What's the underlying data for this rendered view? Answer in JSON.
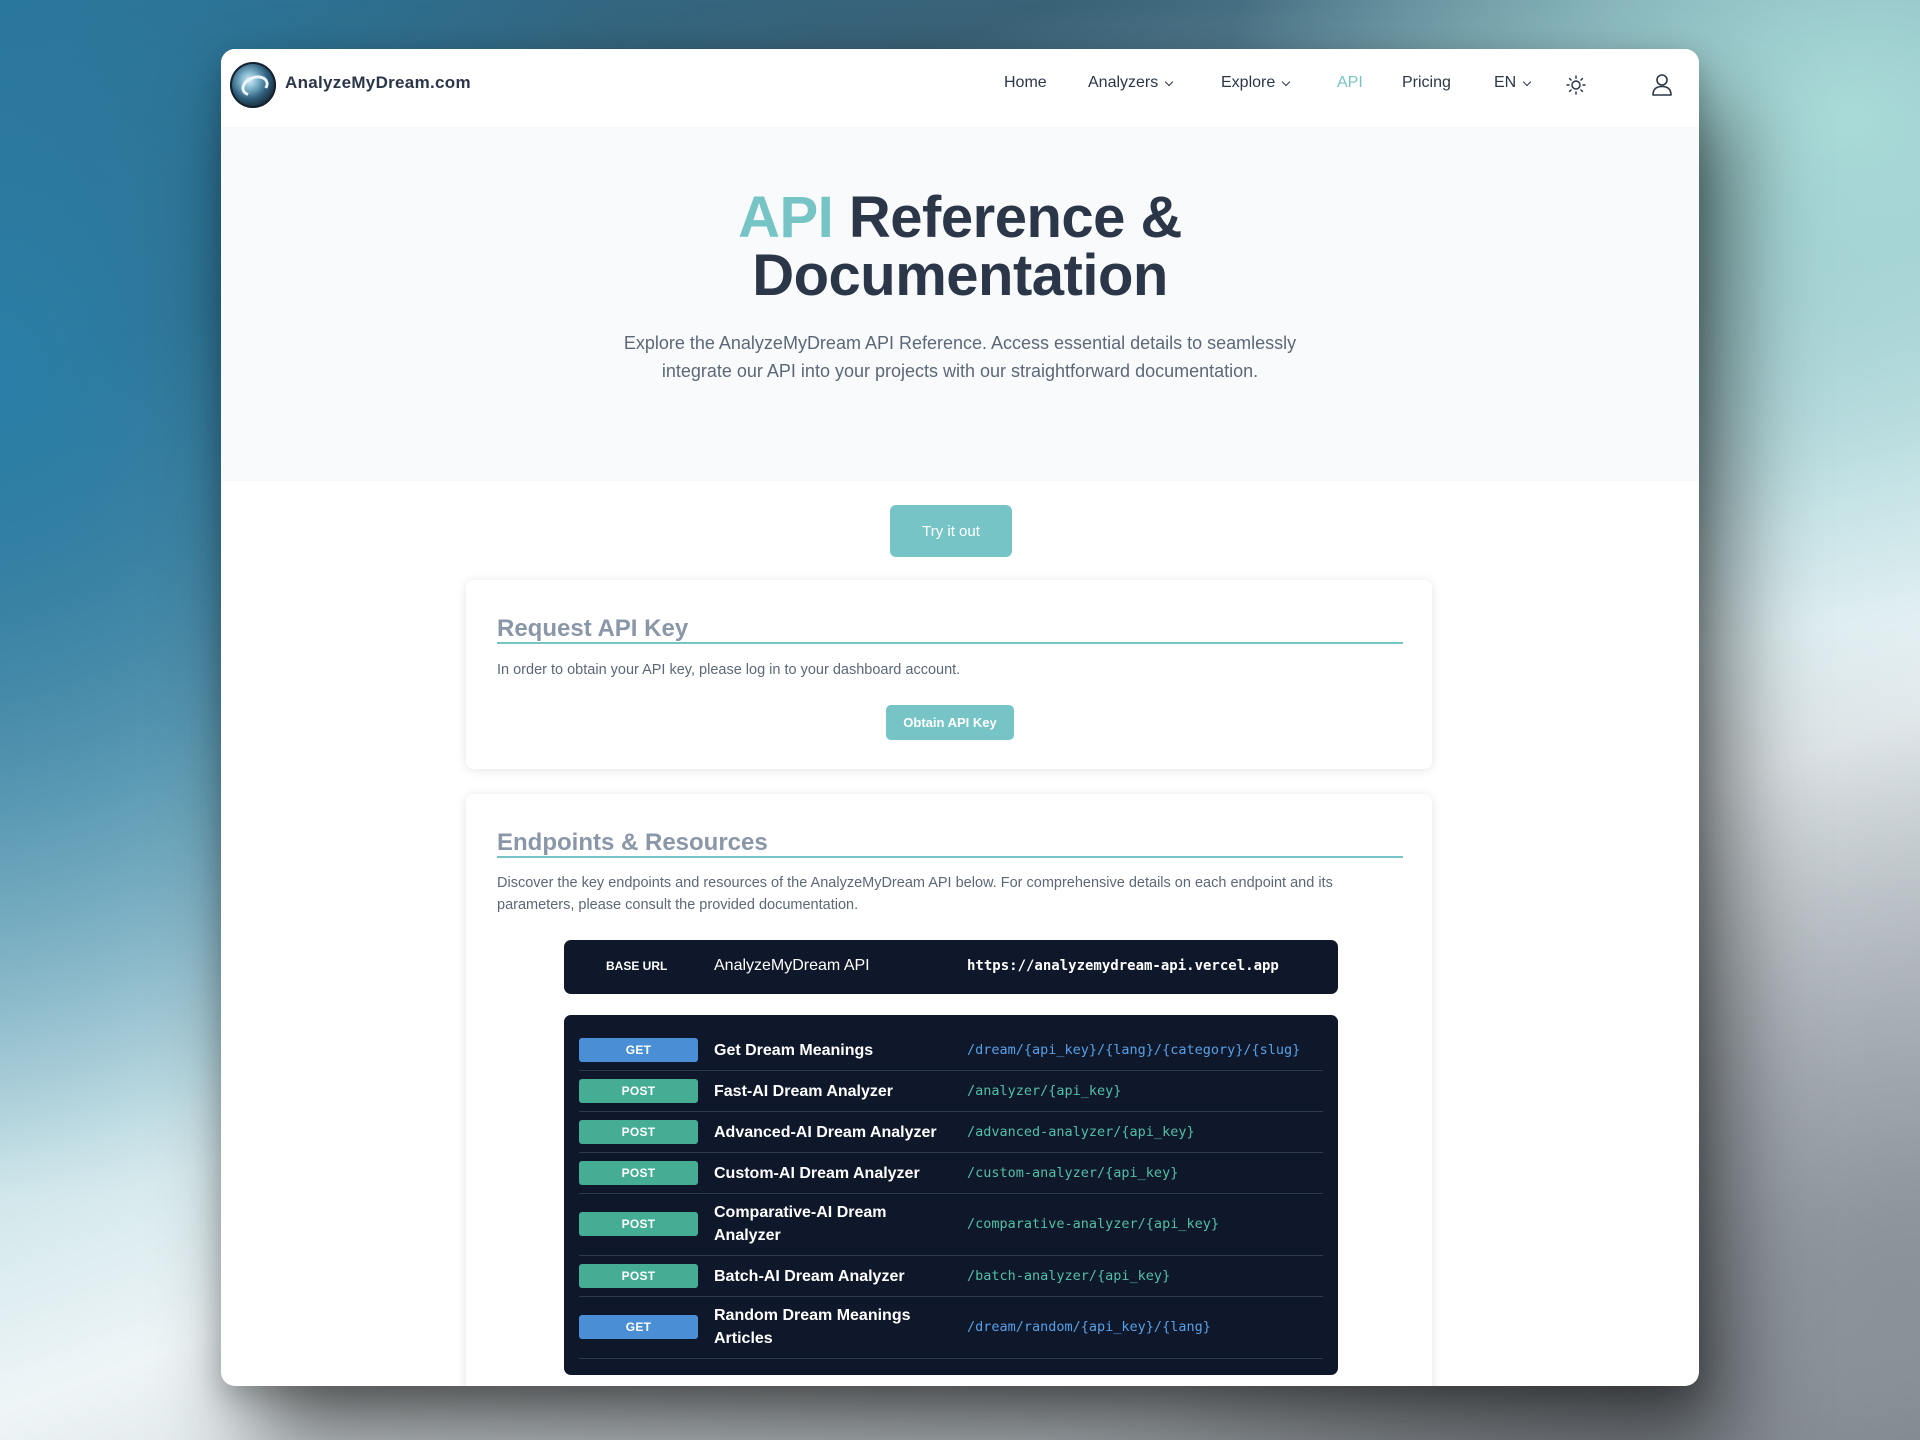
{
  "brand": {
    "name": "AnalyzeMyDream.com"
  },
  "nav": {
    "home": "Home",
    "analyzers": "Analyzers",
    "explore": "Explore",
    "api": "API",
    "pricing": "Pricing",
    "lang": "EN"
  },
  "hero": {
    "title_accent": "API",
    "title_rest": "Reference &",
    "title_line2": "Documentation",
    "subtitle": "Explore the AnalyzeMyDream API Reference. Access essential details to seamlessly integrate our API into your projects with our straightforward documentation."
  },
  "try_button": "Try it out",
  "request_card": {
    "title": "Request API Key",
    "text": "In order to obtain your API key, please log in to your dashboard account.",
    "button": "Obtain API Key"
  },
  "endpoints_card": {
    "title": "Endpoints & Resources",
    "text": "Discover the key endpoints and resources of the AnalyzeMyDream API below. For comprehensive details on each endpoint and its parameters, please consult the provided documentation."
  },
  "base": {
    "tag": "BASE URL",
    "name": "AnalyzeMyDream API",
    "url": "https://analyzemydream-api.vercel.app"
  },
  "endpoints": [
    {
      "method": "GET",
      "name": "Get Dream Meanings",
      "path": "/dream/{api_key}/{lang}/{category}/{slug}"
    },
    {
      "method": "POST",
      "name": "Fast-AI Dream Analyzer",
      "path": "/analyzer/{api_key}"
    },
    {
      "method": "POST",
      "name": "Advanced-AI Dream Analyzer",
      "path": "/advanced-analyzer/{api_key}"
    },
    {
      "method": "POST",
      "name": "Custom-AI Dream Analyzer",
      "path": "/custom-analyzer/{api_key}"
    },
    {
      "method": "POST",
      "name": "Comparative-AI Dream Analyzer",
      "path": "/comparative-analyzer/{api_key}"
    },
    {
      "method": "POST",
      "name": "Batch-AI Dream Analyzer",
      "path": "/batch-analyzer/{api_key}"
    },
    {
      "method": "GET",
      "name": "Random Dream Meanings Articles",
      "path": "/dream/random/{api_key}/{lang}"
    }
  ],
  "colors": {
    "accent": "#77c4c6",
    "dark_text": "#2b3648",
    "panel": "#0f172a",
    "get_badge": "#4a8fd6",
    "post_badge": "#46ad95"
  },
  "icons": {
    "theme_toggle": "sun-icon",
    "account": "user-icon",
    "dropdown": "chevron-down-icon"
  }
}
